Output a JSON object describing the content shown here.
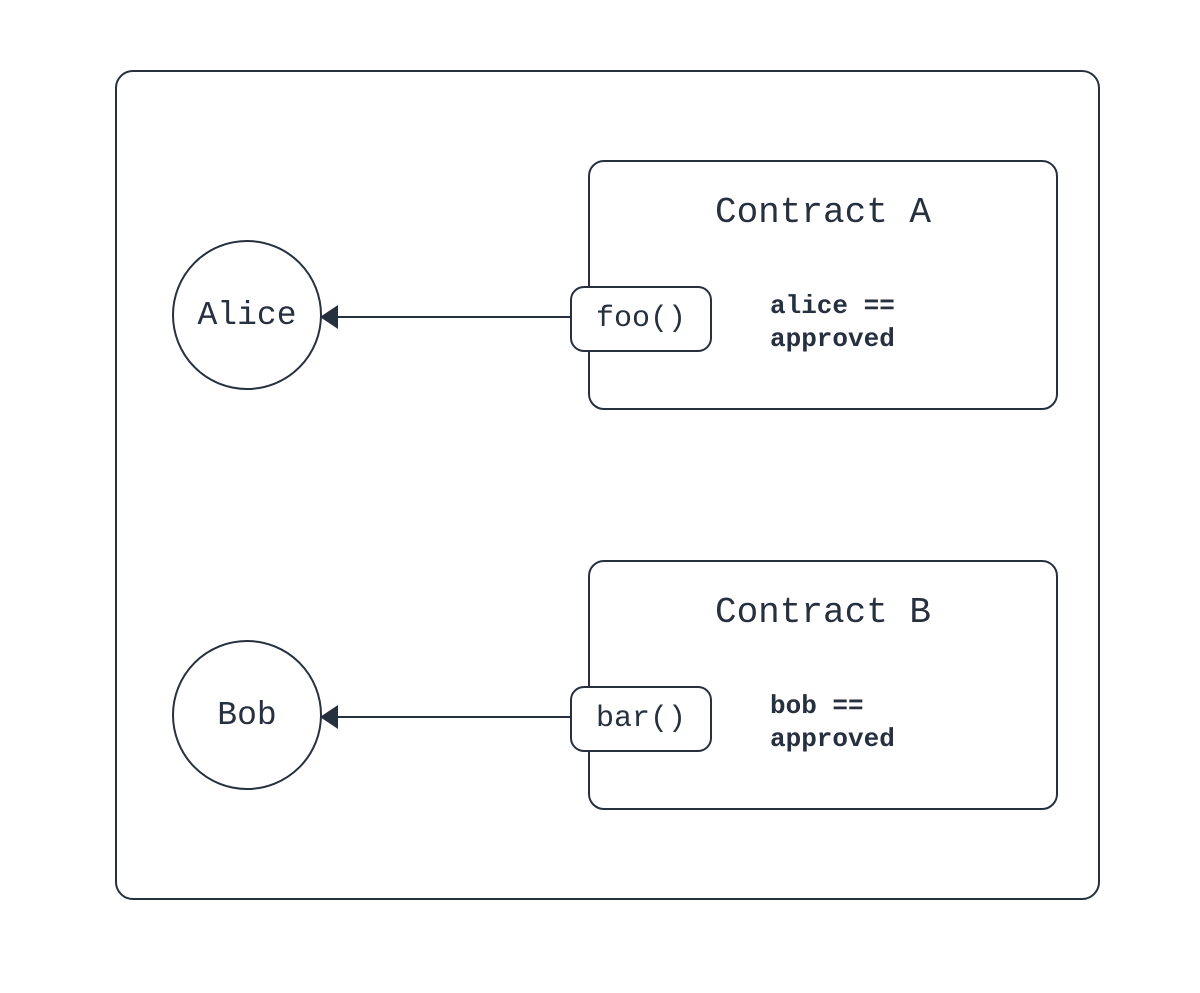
{
  "actors": {
    "alice": "Alice",
    "bob": "Bob"
  },
  "contracts": {
    "a": {
      "title": "Contract A",
      "method": "foo()",
      "condition_line1": "alice ==",
      "condition_line2": "approved"
    },
    "b": {
      "title": "Contract B",
      "method": "bar()",
      "condition_line1": "bob ==",
      "condition_line2": "approved"
    }
  },
  "colors": {
    "stroke": "#27303f",
    "background": "#ffffff"
  }
}
